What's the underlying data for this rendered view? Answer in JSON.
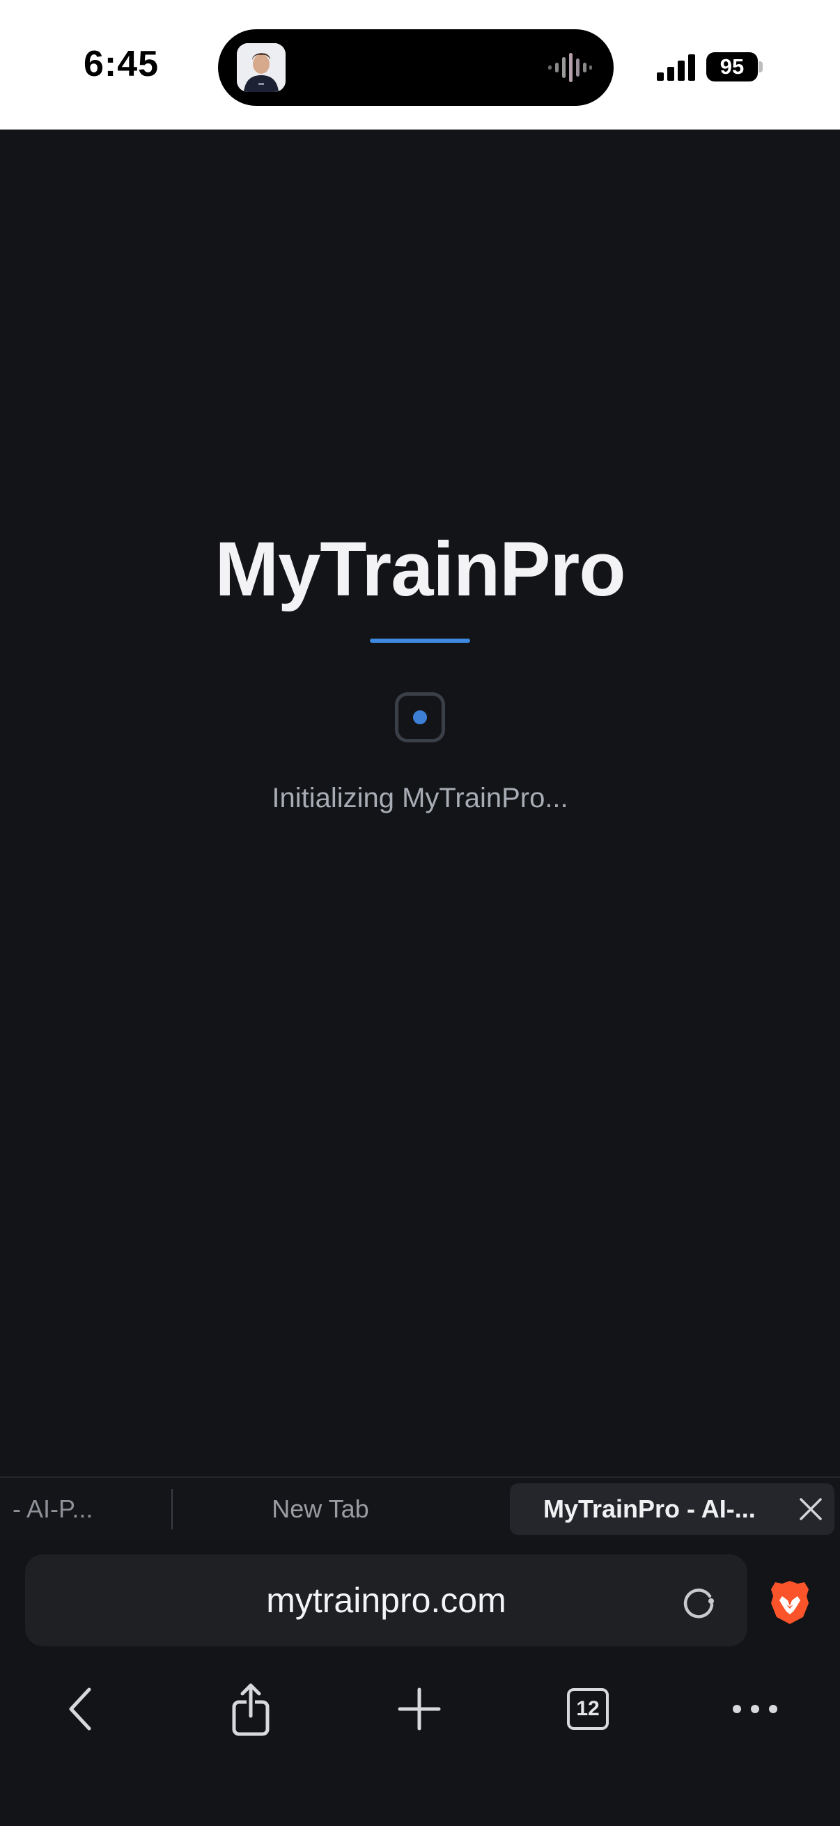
{
  "status_bar": {
    "time": "6:45",
    "battery": "95"
  },
  "page": {
    "title": "MyTrainPro",
    "loading_text": "Initializing MyTrainPro..."
  },
  "tabs": [
    {
      "label": "- AI-P..."
    },
    {
      "label": "New Tab"
    },
    {
      "label": "MyTrainPro - AI-..."
    }
  ],
  "url_bar": {
    "url": "mytrainpro.com"
  },
  "toolbar": {
    "tab_count": "12"
  },
  "colors": {
    "background": "#131417",
    "accent": "#3f8ae0",
    "brave": "#fb542b"
  }
}
